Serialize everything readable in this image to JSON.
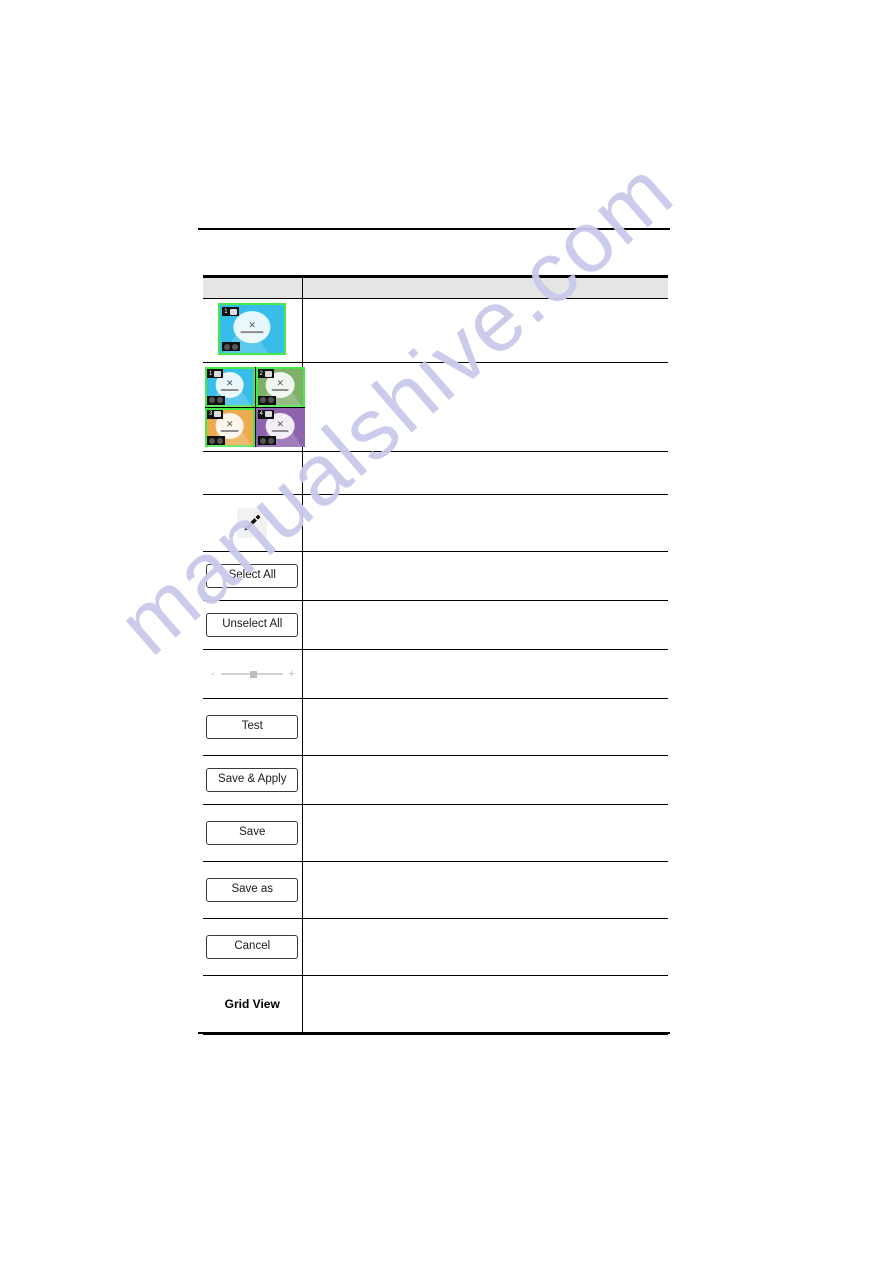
{
  "page": {
    "top_rule": true,
    "bottom_rule": true
  },
  "watermark": {
    "text": "manualshive.com",
    "color": "#c9c9ec"
  },
  "table": {
    "header": {
      "left": "",
      "right": ""
    },
    "rows": [
      {
        "id": "row-single-view-thumbnail",
        "left_kind": "camera-single",
        "right": "",
        "camera": {
          "index": "1",
          "bg": "#36bdea",
          "selected": true
        }
      },
      {
        "id": "row-grid-view-thumbnail",
        "left_kind": "camera-grid",
        "right": "",
        "cameras": [
          {
            "index": "1",
            "bg": "#36bdea",
            "selected": true
          },
          {
            "index": "2",
            "bg": "#7fb069",
            "selected": true
          },
          {
            "index": "3",
            "bg": "#edab4f",
            "selected": true
          },
          {
            "index": "4",
            "bg": "#8e63ad",
            "selected": false
          }
        ]
      },
      {
        "id": "row-blank",
        "left_kind": "empty",
        "right": ""
      },
      {
        "id": "row-edit",
        "left_kind": "pencil-icon",
        "right": ""
      },
      {
        "id": "row-select-all",
        "left_kind": "button",
        "label": "Select All",
        "right": ""
      },
      {
        "id": "row-unselect-all",
        "left_kind": "button",
        "label": "Unselect All",
        "right": ""
      },
      {
        "id": "row-slider",
        "left_kind": "slider",
        "minus": "-",
        "plus": "+",
        "right": ""
      },
      {
        "id": "row-test",
        "left_kind": "button",
        "label": "Test",
        "right": ""
      },
      {
        "id": "row-save-apply",
        "left_kind": "button",
        "label": "Save & Apply",
        "right": ""
      },
      {
        "id": "row-save",
        "left_kind": "button",
        "label": "Save",
        "right": ""
      },
      {
        "id": "row-save-as",
        "left_kind": "button",
        "label": "Save as",
        "right": ""
      },
      {
        "id": "row-cancel",
        "left_kind": "button",
        "label": "Cancel",
        "right": ""
      },
      {
        "id": "row-grid-view",
        "left_kind": "bold-text",
        "label": "Grid View",
        "right": ""
      }
    ]
  }
}
